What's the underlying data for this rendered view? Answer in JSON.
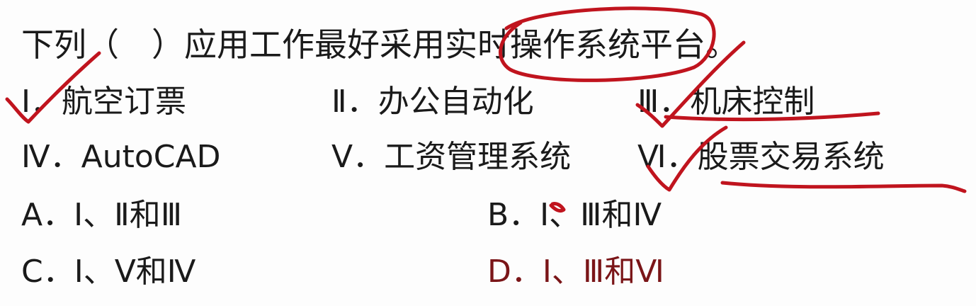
{
  "question": "下列（　）应用工作最好采用实时操作系统平台。",
  "items": [
    {
      "label": "Ⅰ．航空订票"
    },
    {
      "label": "Ⅱ．办公自动化"
    },
    {
      "label": "Ⅲ．机床控制"
    },
    {
      "label": "Ⅳ．AutoCAD"
    },
    {
      "label": "Ⅴ．工资管理系统"
    },
    {
      "label": "Ⅵ．股票交易系统"
    }
  ],
  "choices": [
    {
      "label": "A．Ⅰ、Ⅱ和Ⅲ"
    },
    {
      "label": "B．Ⅰ、Ⅲ和Ⅳ"
    },
    {
      "label": "C．Ⅰ、Ⅴ和Ⅳ"
    },
    {
      "label": "D．Ⅰ、Ⅲ和Ⅵ"
    }
  ],
  "colors": {
    "text": "#1a1a1a",
    "annotation": "#c0141e",
    "correct_answer": "#7a1518"
  }
}
